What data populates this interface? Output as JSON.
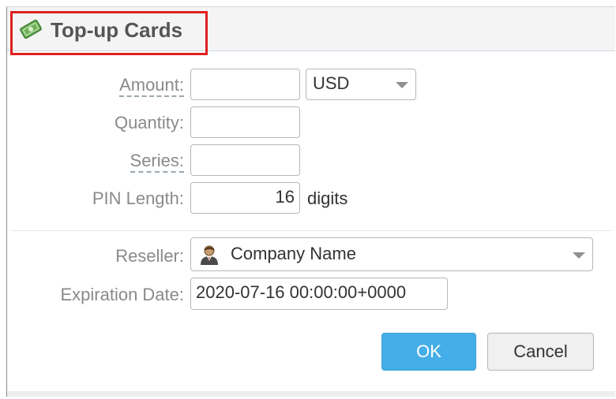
{
  "dialog": {
    "title": "Top-up Cards",
    "icon": "money-icon"
  },
  "form": {
    "amount_label": "Amount:",
    "amount_value": "",
    "currency_value": "USD",
    "quantity_label": "Quantity:",
    "quantity_value": "",
    "series_label": "Series:",
    "series_value": "",
    "pin_length_label": "PIN Length:",
    "pin_length_value": "16",
    "pin_length_unit": "digits",
    "reseller_label": "Reseller:",
    "reseller_value": "Company Name",
    "reseller_icon": "user-icon",
    "expiration_label": "Expiration Date:",
    "expiration_value": "2020-07-16 00:00:00+0000"
  },
  "buttons": {
    "ok_label": "OK",
    "cancel_label": "Cancel"
  },
  "colors": {
    "highlight_border": "#e02020",
    "primary_button": "#45aee8"
  }
}
